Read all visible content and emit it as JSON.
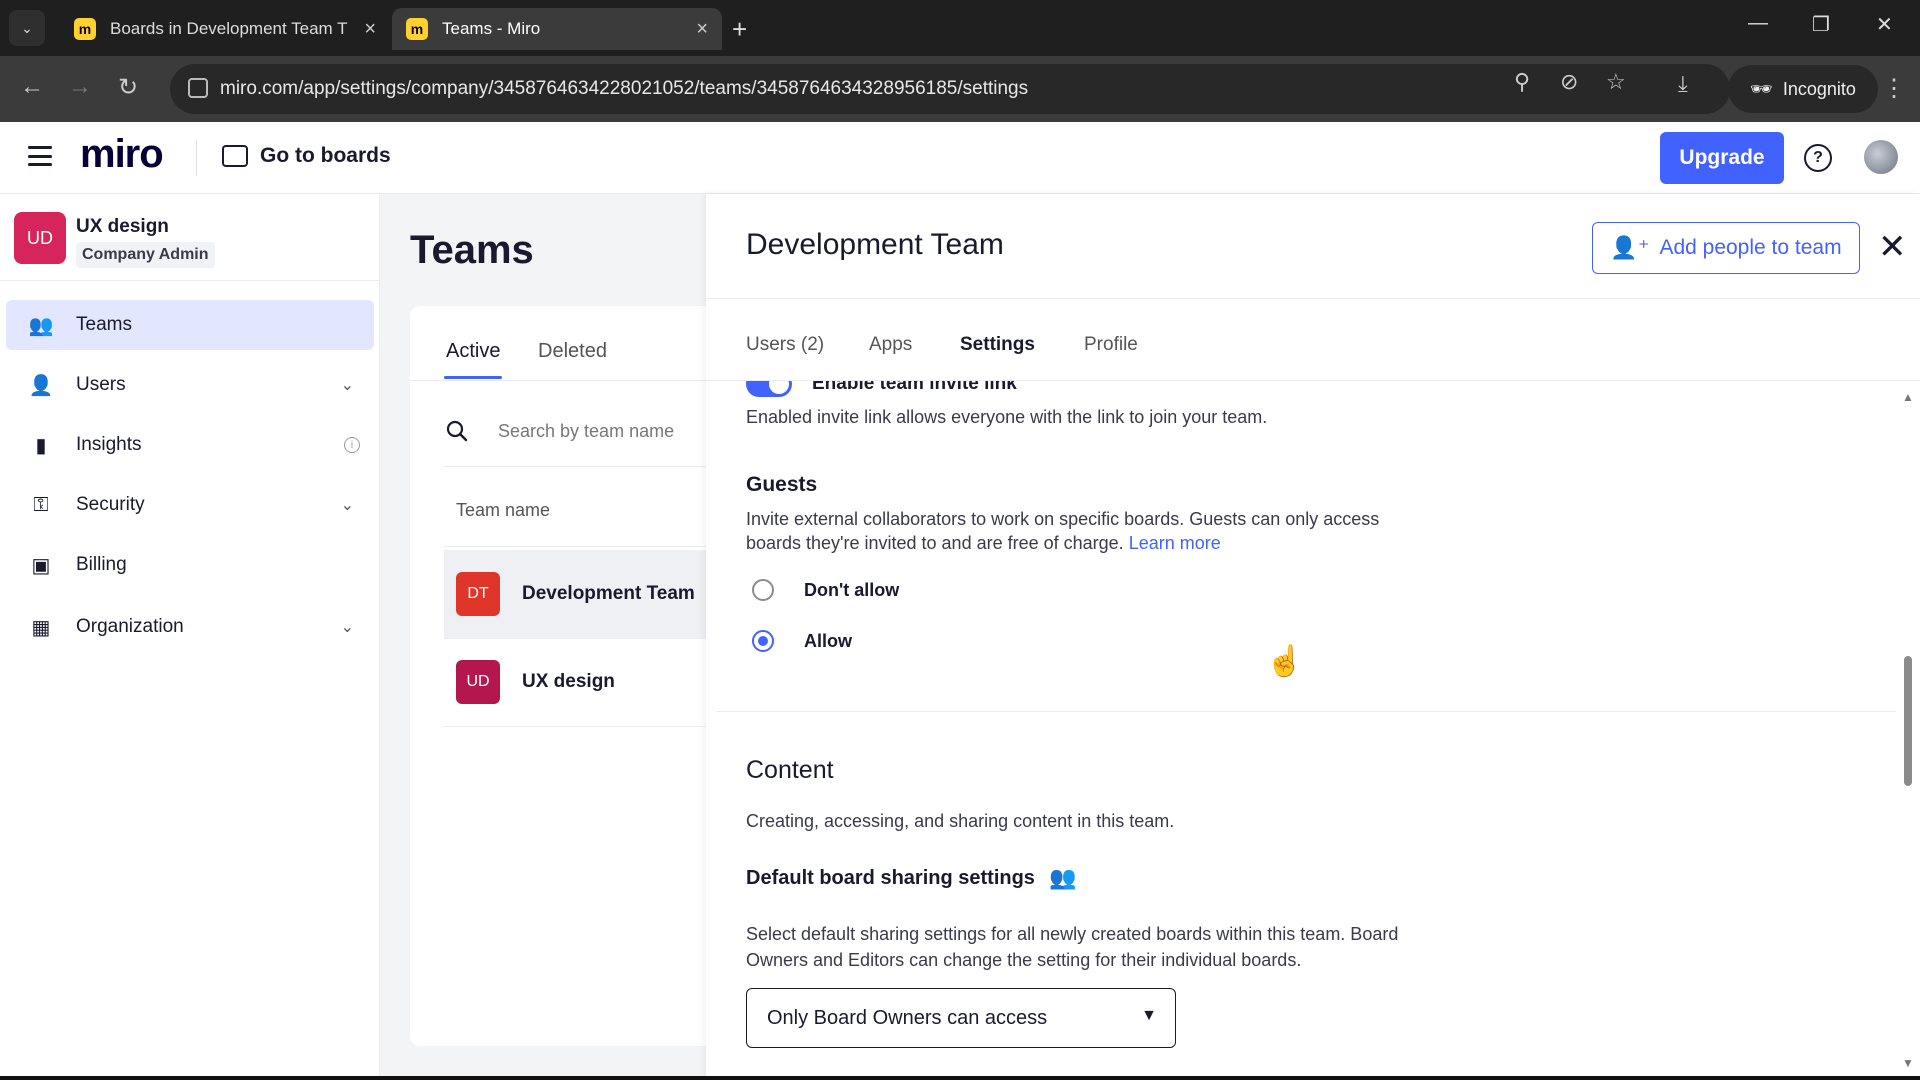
{
  "browser": {
    "tabs": [
      {
        "title": "Boards in Development Team T",
        "favicon": "miro-icon",
        "active": false
      },
      {
        "title": "Teams - Miro",
        "favicon": "miro-icon",
        "active": true
      }
    ],
    "url": "miro.com/app/settings/company/3458764634228021052/teams/3458764634328956185/settings",
    "incognito_label": "Incognito"
  },
  "header": {
    "logo": "miro",
    "go_to_boards": "Go to boards",
    "upgrade_label": "Upgrade",
    "accent": "#4262ff"
  },
  "sidebar": {
    "org": {
      "initials": "UD",
      "name": "UX design",
      "role": "Company Admin",
      "color": "#d6255a"
    },
    "items": [
      {
        "label": "Teams",
        "icon": "teams-icon",
        "active": true
      },
      {
        "label": "Users",
        "icon": "users-icon",
        "expandable": true
      },
      {
        "label": "Insights",
        "icon": "insights-icon",
        "info": true
      },
      {
        "label": "Security",
        "icon": "security-icon",
        "expandable": true
      },
      {
        "label": "Billing",
        "icon": "billing-icon"
      },
      {
        "label": "Organization",
        "icon": "organization-icon",
        "expandable": true
      }
    ]
  },
  "teams": {
    "title": "Teams",
    "tabs": [
      "Active",
      "Deleted"
    ],
    "search_placeholder": "Search by team name",
    "column_header": "Team name",
    "rows": [
      {
        "initials": "DT",
        "name": "Development Team",
        "color": "#e0352b",
        "selected": true
      },
      {
        "initials": "UD",
        "name": "UX design",
        "color": "#b3174d",
        "selected": false
      }
    ]
  },
  "panel": {
    "title": "Development Team",
    "add_people_label": "Add people to team",
    "tabs": [
      "Users (2)",
      "Apps",
      "Settings",
      "Profile"
    ],
    "active_tab": "Settings",
    "invite_link": {
      "label": "Enable team invite link",
      "enabled": true,
      "description": "Enabled invite link allows everyone with the link to join your team."
    },
    "guests": {
      "title": "Guests",
      "description": "Invite external collaborators to work on specific boards. Guests can only access boards they're invited to and are free of charge.",
      "learn_more": "Learn more",
      "options": [
        "Don't allow",
        "Allow"
      ],
      "selected": "Allow"
    },
    "content": {
      "title": "Content",
      "description": "Creating, accessing, and sharing content in this team.",
      "sharing_title": "Default board sharing settings",
      "sharing_description": "Select default sharing settings for all newly created boards within this team. Board Owners and Editors can change the setting for their individual boards.",
      "sharing_value": "Only Board Owners can access"
    }
  }
}
